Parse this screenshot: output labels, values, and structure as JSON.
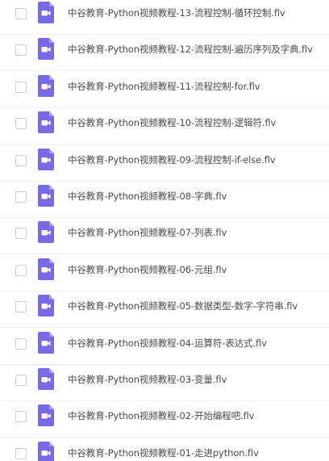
{
  "file_list": {
    "icon": "video-file-icon",
    "accent_color": "#7869e6",
    "items": [
      {
        "name": "中谷教育-Python视频教程-13-流程控制-循环控制.flv"
      },
      {
        "name": "中谷教育-Python视频教程-12-流程控制-遍历序列及字典.flv"
      },
      {
        "name": "中谷教育-Python视频教程-11-流程控制-for.flv"
      },
      {
        "name": "中谷教育-Python视频教程-10-流程控制-逻辑符.flv"
      },
      {
        "name": "中谷教育-Python视频教程-09-流程控制-if-else.flv"
      },
      {
        "name": "中谷教育-Python视频教程-08-字典.flv"
      },
      {
        "name": "中谷教育-Python视频教程-07-列表.flv"
      },
      {
        "name": "中谷教育-Python视频教程-06-元组.flv"
      },
      {
        "name": "中谷教育-Python视频教程-05-数据类型-数字-字符串.flv"
      },
      {
        "name": "中谷教育-Python视频教程-04-运算符-表达式.flv"
      },
      {
        "name": "中谷教育-Python视频教程-03-变量.flv"
      },
      {
        "name": "中谷教育-Python视频教程-02-开始编程吧.flv"
      },
      {
        "name": "中谷教育-Python视频教程-01-走进python.flv"
      }
    ]
  }
}
